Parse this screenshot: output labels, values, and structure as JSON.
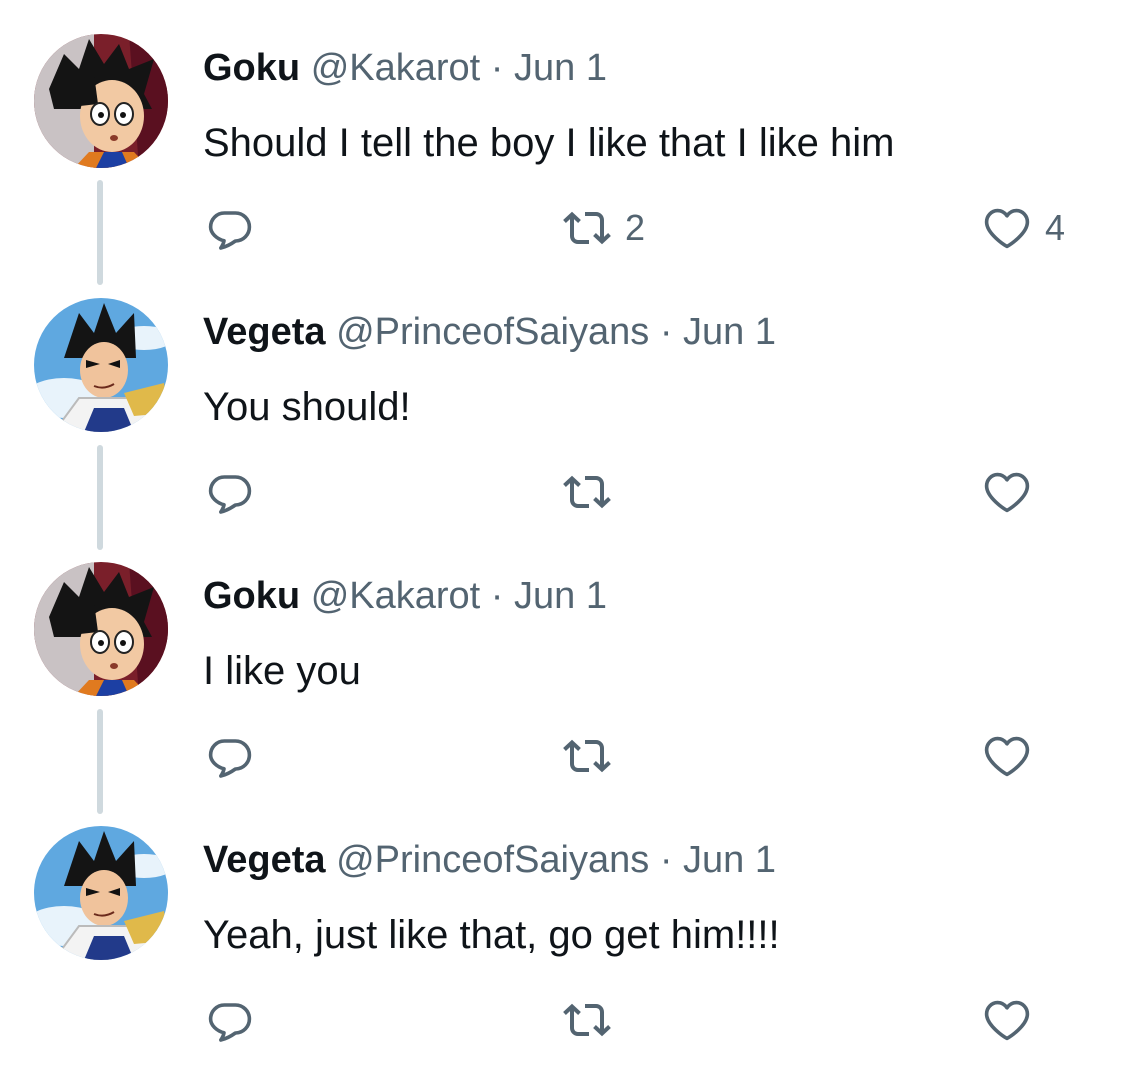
{
  "colors": {
    "text": "#0f1419",
    "secondary": "#536471",
    "connector": "#cfd9de",
    "background": "#ffffff"
  },
  "icons": {
    "reply": "speech-bubble-icon",
    "retweet": "retweet-arrows-icon",
    "like": "heart-outline-icon"
  },
  "tweets": [
    {
      "name": "Goku",
      "handle": "@Kakarot",
      "separator": "·",
      "date": "Jun 1",
      "text": "Should I tell the boy I like that I like him",
      "replies": "",
      "retweets": "2",
      "likes": "4",
      "avatar": "goku-avatar"
    },
    {
      "name": "Vegeta",
      "handle": "@PrinceofSaiyans",
      "separator": "·",
      "date": "Jun 1",
      "text": "You should!",
      "replies": "",
      "retweets": "",
      "likes": "",
      "avatar": "vegeta-avatar"
    },
    {
      "name": "Goku",
      "handle": "@Kakarot",
      "separator": "·",
      "date": "Jun 1",
      "text": "I like you",
      "replies": "",
      "retweets": "",
      "likes": "",
      "avatar": "goku-avatar"
    },
    {
      "name": "Vegeta",
      "handle": "@PrinceofSaiyans",
      "separator": "·",
      "date": "Jun 1",
      "text": "Yeah, just like that, go get him!!!!",
      "replies": "",
      "retweets": "",
      "likes": "",
      "avatar": "vegeta-avatar"
    }
  ]
}
